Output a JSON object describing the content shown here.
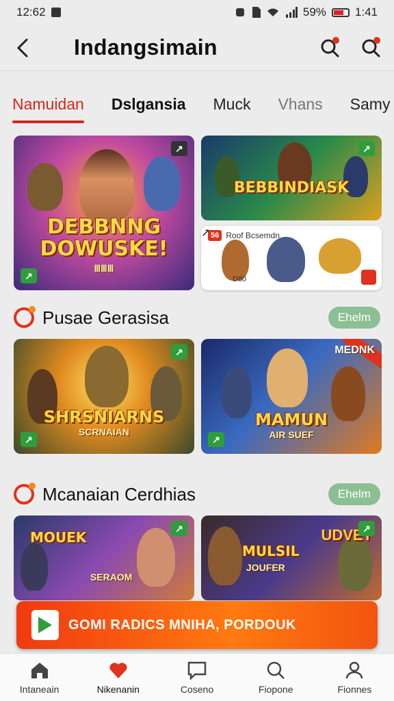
{
  "status": {
    "time": "12:62",
    "battery": "59%",
    "clock": "1:41"
  },
  "appbar": {
    "title": "Indangsimain"
  },
  "tabs": [
    {
      "label": "Namuidan",
      "style": "active"
    },
    {
      "label": "Dslgansia",
      "style": "bold"
    },
    {
      "label": "Muck",
      "style": ""
    },
    {
      "label": "Vhans",
      "style": "muted"
    },
    {
      "label": "Samy",
      "style": ""
    }
  ],
  "featured": {
    "big": {
      "title": "DEBBNNG DOWUSKE!",
      "sub": "ⅢⅢⅢ"
    },
    "top_right": {
      "title": "BEBBINDIASK"
    },
    "bottom_right": {
      "heading": "Roof Bcsemdn",
      "code": "56",
      "footer": "D80"
    }
  },
  "sections": [
    {
      "title": "Pusae Gerasisa",
      "action": "Ehelm",
      "cards": [
        {
          "title": "SHRSNIARNS",
          "sub": "SCRNAIAN"
        },
        {
          "title": "MAMUN",
          "sub": "AIR SUEF",
          "corner": "MEDNK"
        }
      ]
    },
    {
      "title": "Mcanaian Cerdhias",
      "action": "Ehelm",
      "cards": [
        {
          "title": "MOUEK",
          "sub": "SERAOM"
        },
        {
          "title": "MULSIL",
          "sub": "JOUFER",
          "corner": "UDVET"
        }
      ]
    }
  ],
  "cta": {
    "label": "GOMI RADICS MNIHA, PORDOUK"
  },
  "nav": [
    {
      "label": "Intaneain",
      "icon": "home-icon"
    },
    {
      "label": "Nikenanin",
      "icon": "heart-icon"
    },
    {
      "label": "Coseno",
      "icon": "chat-icon"
    },
    {
      "label": "Fiopone",
      "icon": "search-icon"
    },
    {
      "label": "Fionnes",
      "icon": "profile-icon"
    }
  ]
}
